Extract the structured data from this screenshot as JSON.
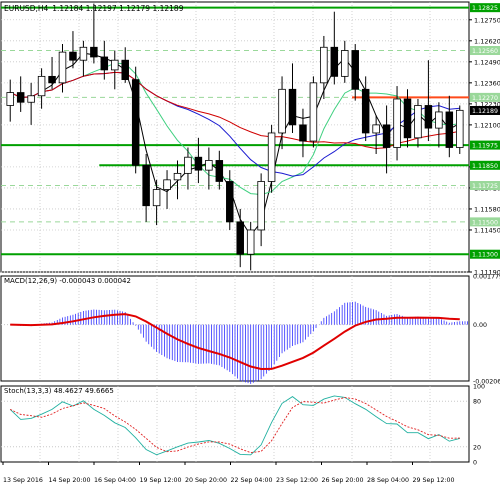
{
  "header": {
    "symbol": "EURUSD,H4",
    "ohlc": "1.12184 1.12197 1.12179 1.12189"
  },
  "main_panel": {
    "price_range": [
      1.1119,
      1.1286
    ],
    "price_ticks": [
      "1.12750",
      "1.12620",
      "1.12490",
      "1.12360",
      "1.12230",
      "1.12100",
      "1.11840",
      "1.11710",
      "1.11580",
      "1.11450",
      "1.11190"
    ],
    "current_price_label": "1.12189",
    "levels": [
      {
        "price": 1.12825,
        "label": "1.12825",
        "color": "#00a000",
        "style": "solid"
      },
      {
        "price": 1.1256,
        "label": "1.12560",
        "color": "#9ad89a",
        "style": "dashed"
      },
      {
        "price": 1.1227,
        "label": "1.12270",
        "color": "#9ad89a",
        "style": "dashed"
      },
      {
        "price": 1.1227,
        "label": "",
        "color": "#ff4a1a",
        "style": "solid",
        "from_fraction": 0.75
      },
      {
        "price": 1.11975,
        "label": "1.11975",
        "color": "#00a000",
        "style": "solid"
      },
      {
        "price": 1.1185,
        "label": "1.11850",
        "color": "#00a000",
        "style": "solid",
        "from_fraction": 0.21
      },
      {
        "price": 1.11725,
        "label": "1.11725",
        "color": "#9ad89a",
        "style": "dashed"
      },
      {
        "price": 1.115,
        "label": "1.11500",
        "color": "#9ad89a",
        "style": "dashed"
      },
      {
        "price": 1.113,
        "label": "1.11300",
        "color": "#00a000",
        "style": "solid"
      }
    ],
    "candles": [
      [
        1.1222,
        1.1238,
        1.1212,
        1.123
      ],
      [
        1.123,
        1.124,
        1.1218,
        1.1224
      ],
      [
        1.1224,
        1.1236,
        1.121,
        1.1228
      ],
      [
        1.1228,
        1.1245,
        1.122,
        1.124
      ],
      [
        1.124,
        1.1252,
        1.1232,
        1.1236
      ],
      [
        1.1236,
        1.126,
        1.123,
        1.1255
      ],
      [
        1.1255,
        1.1268,
        1.1245,
        1.125
      ],
      [
        1.125,
        1.1262,
        1.124,
        1.1258
      ],
      [
        1.1258,
        1.1285,
        1.1248,
        1.1252
      ],
      [
        1.1252,
        1.1262,
        1.1238,
        1.1244
      ],
      [
        1.1244,
        1.1256,
        1.1232,
        1.125
      ],
      [
        1.125,
        1.1258,
        1.1236,
        1.1238
      ],
      [
        1.1238,
        1.1246,
        1.118,
        1.1185
      ],
      [
        1.1185,
        1.1192,
        1.115,
        1.116
      ],
      [
        1.116,
        1.1176,
        1.1148,
        1.117
      ],
      [
        1.117,
        1.1182,
        1.1158,
        1.1176
      ],
      [
        1.1176,
        1.1188,
        1.1164,
        1.118
      ],
      [
        1.118,
        1.1196,
        1.117,
        1.119
      ],
      [
        1.119,
        1.1202,
        1.1174,
        1.1182
      ],
      [
        1.1182,
        1.1196,
        1.117,
        1.1188
      ],
      [
        1.1188,
        1.1194,
        1.117,
        1.1175
      ],
      [
        1.1175,
        1.1182,
        1.1145,
        1.115
      ],
      [
        1.115,
        1.1158,
        1.1122,
        1.113
      ],
      [
        1.113,
        1.115,
        1.112,
        1.1145
      ],
      [
        1.1145,
        1.118,
        1.1135,
        1.1175
      ],
      [
        1.1175,
        1.121,
        1.1168,
        1.1205
      ],
      [
        1.1205,
        1.124,
        1.1195,
        1.1232
      ],
      [
        1.1232,
        1.1248,
        1.1205,
        1.121
      ],
      [
        1.121,
        1.122,
        1.119,
        1.12
      ],
      [
        1.12,
        1.124,
        1.1196,
        1.1236
      ],
      [
        1.1236,
        1.1265,
        1.1226,
        1.1258
      ],
      [
        1.1258,
        1.128,
        1.1235,
        1.124
      ],
      [
        1.124,
        1.1262,
        1.1236,
        1.1256
      ],
      [
        1.1256,
        1.126,
        1.1225,
        1.1232
      ],
      [
        1.1232,
        1.124,
        1.12,
        1.1205
      ],
      [
        1.1205,
        1.1216,
        1.1192,
        1.121
      ],
      [
        1.121,
        1.1222,
        1.118,
        1.1196
      ],
      [
        1.1196,
        1.1234,
        1.1188,
        1.1226
      ],
      [
        1.1226,
        1.1232,
        1.1196,
        1.1202
      ],
      [
        1.1202,
        1.1226,
        1.1196,
        1.1222
      ],
      [
        1.1222,
        1.125,
        1.12,
        1.1208
      ],
      [
        1.1208,
        1.1224,
        1.1196,
        1.1218
      ],
      [
        1.1218,
        1.1228,
        1.119,
        1.1196
      ],
      [
        1.1196,
        1.1222,
        1.1192,
        1.1219
      ]
    ]
  },
  "macd_panel": {
    "label": "MACD(12,26,9) -0.000043 0.000042",
    "ticks": [
      "0.001779",
      "0.00",
      "-0.002061"
    ],
    "range": [
      -0.002061,
      0.001779
    ]
  },
  "stoch_panel": {
    "label": "Stoch(13,3,3) 48.4627 49.6665",
    "ticks": [
      "100",
      "80",
      "20",
      "0"
    ],
    "range": [
      0,
      100
    ]
  },
  "time_axis": {
    "labels": [
      "13 Sep 2016",
      "14 Sep 20:00",
      "16 Sep 04:00",
      "19 Sep 12:00",
      "20 Sep 20:00",
      "22 Sep 04:00",
      "23 Sep 12:00",
      "26 Sep 20:00",
      "28 Sep 04:00",
      "29 Sep 12:00"
    ]
  },
  "colors": {
    "bull": "#00a000",
    "bear": "#000000",
    "ma_blue": "#1a1ad0",
    "ma_red": "#d00000",
    "ma_green": "#40d080",
    "ma_black": "#000000",
    "macd_hist": "#3030ff",
    "macd_signal": "#e00000",
    "stoch_main": "#20b0a0",
    "stoch_signal": "#e02020"
  }
}
